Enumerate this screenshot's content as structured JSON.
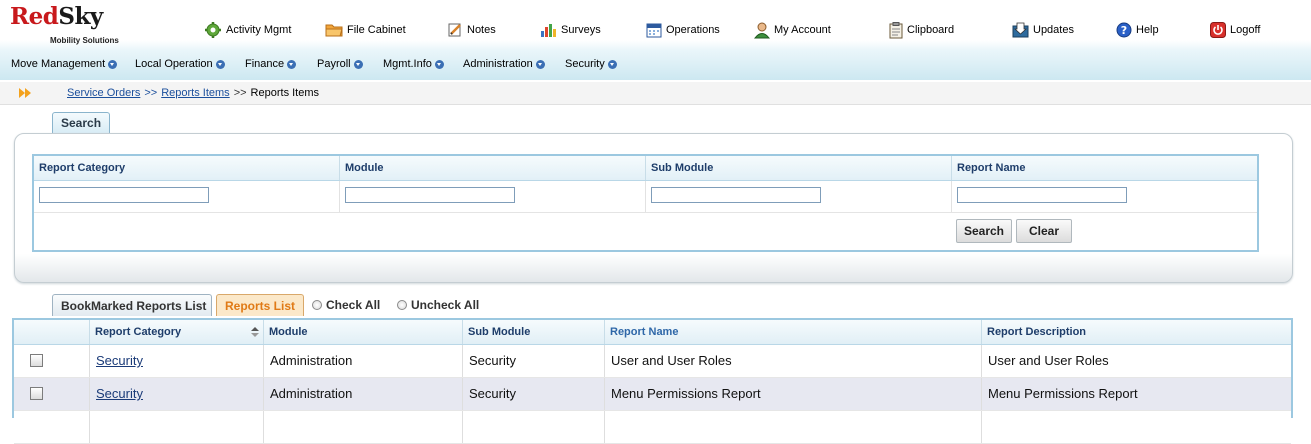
{
  "logo": {
    "red": "Red",
    "black": "Sky",
    "sub": "Mobility Solutions"
  },
  "topnav": [
    {
      "label": "Activity Mgmt",
      "icon": "gear-icon"
    },
    {
      "label": "File Cabinet",
      "icon": "folder-icon"
    },
    {
      "label": "Notes",
      "icon": "notes-icon"
    },
    {
      "label": "Surveys",
      "icon": "bar-chart-icon"
    },
    {
      "label": "Operations",
      "icon": "calendar-icon"
    },
    {
      "label": "My Account",
      "icon": "user-icon"
    },
    {
      "label": "Clipboard",
      "icon": "clipboard-icon"
    },
    {
      "label": "Updates",
      "icon": "updates-icon"
    },
    {
      "label": "Help",
      "icon": "help-icon"
    },
    {
      "label": "Logoff",
      "icon": "power-icon"
    }
  ],
  "menu": [
    "Move Management",
    "Local Operation",
    "Finance",
    "Payroll",
    "Mgmt.Info",
    "Administration",
    "Security"
  ],
  "breadcrumb": {
    "link1": "Service Orders",
    "sep1": ">>",
    "link2": "Reports Items",
    "sep2": ">>",
    "current": "Reports Items"
  },
  "search": {
    "tab": "Search",
    "columns": [
      "Report Category",
      "Module",
      "Sub Module",
      "Report Name"
    ],
    "values": [
      "",
      "",
      "",
      ""
    ],
    "search_button": "Search",
    "clear_button": "Clear"
  },
  "tabs": {
    "bookmarked": "BookMarked Reports List",
    "reports": "Reports List"
  },
  "check_all": "Check All",
  "uncheck_all": "Uncheck All",
  "table": {
    "headers": [
      "Report Category",
      "Module",
      "Sub Module",
      "Report Name",
      "Report Description"
    ],
    "rows": [
      {
        "category": "Security",
        "module": "Administration",
        "sub_module": "Security",
        "name": "User and User Roles",
        "description": "User and User Roles"
      },
      {
        "category": "Security",
        "module": "Administration",
        "sub_module": "Security",
        "name": "Menu Permissions Report",
        "description": "Menu Permissions Report"
      }
    ]
  },
  "colors": {
    "brand_red": "#c8191c",
    "link_blue": "#1b4f9c",
    "active_tab_orange": "#e07a16",
    "grid_border": "#9cc8e0"
  }
}
